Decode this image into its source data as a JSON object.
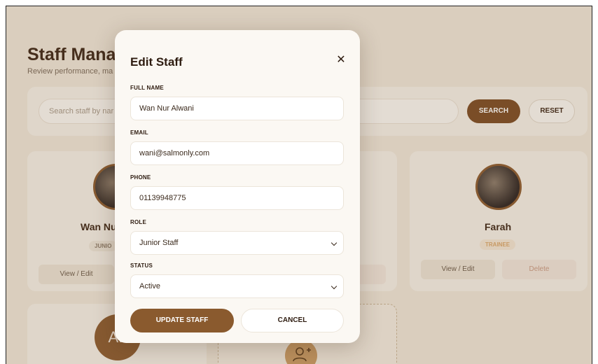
{
  "page": {
    "title": "Staff Mana",
    "subtitle": "Review performance, ma"
  },
  "search": {
    "placeholder": "Search staff by nar",
    "search_label": "SEARCH",
    "reset_label": "RESET"
  },
  "cards": [
    {
      "name": "Wan Nu",
      "badge": "JUNIO",
      "view_label": "View / Edit"
    },
    {
      "name": "Farah",
      "badge": "TRAINEE",
      "view_label": "View / Edit",
      "delete_label": "Delete"
    }
  ],
  "extra_card": {
    "initials": "AL"
  },
  "add_card": {
    "icon": "add-user-icon"
  },
  "modal": {
    "title": "Edit Staff",
    "close_icon": "close-icon",
    "fields": {
      "full_name": {
        "label": "FULL NAME",
        "value": "Wan Nur Alwani"
      },
      "email": {
        "label": "EMAIL",
        "value": "wani@salmonly.com"
      },
      "phone": {
        "label": "PHONE",
        "value": "01139948775"
      },
      "role": {
        "label": "ROLE",
        "value": "Junior Staff"
      },
      "status": {
        "label": "STATUS",
        "value": "Active"
      }
    },
    "update_label": "UPDATE STAFF",
    "cancel_label": "CANCEL"
  },
  "colors": {
    "accent": "#8a5a2e",
    "background": "#efe7da",
    "modal": "#fbf8f3"
  }
}
